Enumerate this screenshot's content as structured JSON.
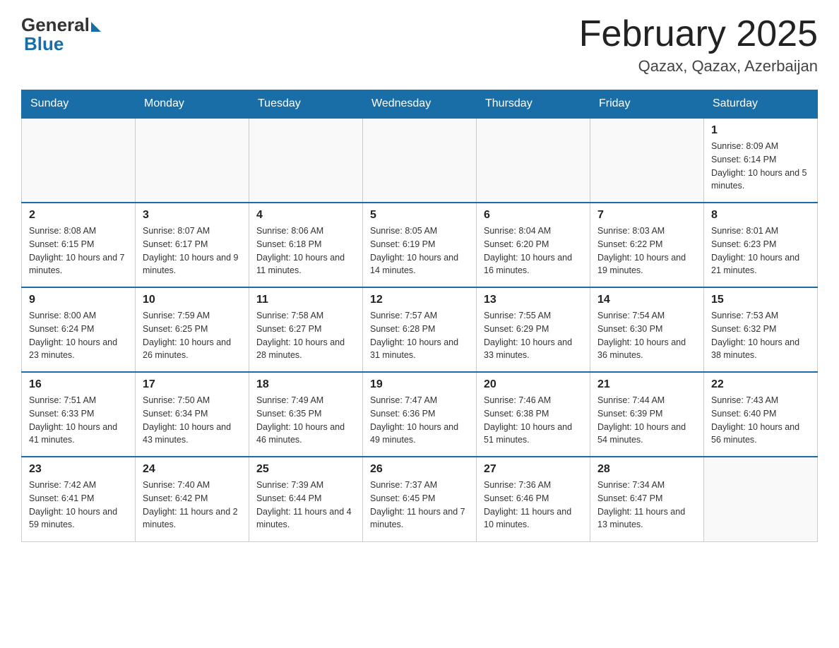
{
  "header": {
    "logo_general": "General",
    "logo_blue": "Blue",
    "main_title": "February 2025",
    "subtitle": "Qazax, Qazax, Azerbaijan"
  },
  "weekdays": [
    "Sunday",
    "Monday",
    "Tuesday",
    "Wednesday",
    "Thursday",
    "Friday",
    "Saturday"
  ],
  "weeks": [
    [
      {
        "day": "",
        "info": ""
      },
      {
        "day": "",
        "info": ""
      },
      {
        "day": "",
        "info": ""
      },
      {
        "day": "",
        "info": ""
      },
      {
        "day": "",
        "info": ""
      },
      {
        "day": "",
        "info": ""
      },
      {
        "day": "1",
        "info": "Sunrise: 8:09 AM\nSunset: 6:14 PM\nDaylight: 10 hours and 5 minutes."
      }
    ],
    [
      {
        "day": "2",
        "info": "Sunrise: 8:08 AM\nSunset: 6:15 PM\nDaylight: 10 hours and 7 minutes."
      },
      {
        "day": "3",
        "info": "Sunrise: 8:07 AM\nSunset: 6:17 PM\nDaylight: 10 hours and 9 minutes."
      },
      {
        "day": "4",
        "info": "Sunrise: 8:06 AM\nSunset: 6:18 PM\nDaylight: 10 hours and 11 minutes."
      },
      {
        "day": "5",
        "info": "Sunrise: 8:05 AM\nSunset: 6:19 PM\nDaylight: 10 hours and 14 minutes."
      },
      {
        "day": "6",
        "info": "Sunrise: 8:04 AM\nSunset: 6:20 PM\nDaylight: 10 hours and 16 minutes."
      },
      {
        "day": "7",
        "info": "Sunrise: 8:03 AM\nSunset: 6:22 PM\nDaylight: 10 hours and 19 minutes."
      },
      {
        "day": "8",
        "info": "Sunrise: 8:01 AM\nSunset: 6:23 PM\nDaylight: 10 hours and 21 minutes."
      }
    ],
    [
      {
        "day": "9",
        "info": "Sunrise: 8:00 AM\nSunset: 6:24 PM\nDaylight: 10 hours and 23 minutes."
      },
      {
        "day": "10",
        "info": "Sunrise: 7:59 AM\nSunset: 6:25 PM\nDaylight: 10 hours and 26 minutes."
      },
      {
        "day": "11",
        "info": "Sunrise: 7:58 AM\nSunset: 6:27 PM\nDaylight: 10 hours and 28 minutes."
      },
      {
        "day": "12",
        "info": "Sunrise: 7:57 AM\nSunset: 6:28 PM\nDaylight: 10 hours and 31 minutes."
      },
      {
        "day": "13",
        "info": "Sunrise: 7:55 AM\nSunset: 6:29 PM\nDaylight: 10 hours and 33 minutes."
      },
      {
        "day": "14",
        "info": "Sunrise: 7:54 AM\nSunset: 6:30 PM\nDaylight: 10 hours and 36 minutes."
      },
      {
        "day": "15",
        "info": "Sunrise: 7:53 AM\nSunset: 6:32 PM\nDaylight: 10 hours and 38 minutes."
      }
    ],
    [
      {
        "day": "16",
        "info": "Sunrise: 7:51 AM\nSunset: 6:33 PM\nDaylight: 10 hours and 41 minutes."
      },
      {
        "day": "17",
        "info": "Sunrise: 7:50 AM\nSunset: 6:34 PM\nDaylight: 10 hours and 43 minutes."
      },
      {
        "day": "18",
        "info": "Sunrise: 7:49 AM\nSunset: 6:35 PM\nDaylight: 10 hours and 46 minutes."
      },
      {
        "day": "19",
        "info": "Sunrise: 7:47 AM\nSunset: 6:36 PM\nDaylight: 10 hours and 49 minutes."
      },
      {
        "day": "20",
        "info": "Sunrise: 7:46 AM\nSunset: 6:38 PM\nDaylight: 10 hours and 51 minutes."
      },
      {
        "day": "21",
        "info": "Sunrise: 7:44 AM\nSunset: 6:39 PM\nDaylight: 10 hours and 54 minutes."
      },
      {
        "day": "22",
        "info": "Sunrise: 7:43 AM\nSunset: 6:40 PM\nDaylight: 10 hours and 56 minutes."
      }
    ],
    [
      {
        "day": "23",
        "info": "Sunrise: 7:42 AM\nSunset: 6:41 PM\nDaylight: 10 hours and 59 minutes."
      },
      {
        "day": "24",
        "info": "Sunrise: 7:40 AM\nSunset: 6:42 PM\nDaylight: 11 hours and 2 minutes."
      },
      {
        "day": "25",
        "info": "Sunrise: 7:39 AM\nSunset: 6:44 PM\nDaylight: 11 hours and 4 minutes."
      },
      {
        "day": "26",
        "info": "Sunrise: 7:37 AM\nSunset: 6:45 PM\nDaylight: 11 hours and 7 minutes."
      },
      {
        "day": "27",
        "info": "Sunrise: 7:36 AM\nSunset: 6:46 PM\nDaylight: 11 hours and 10 minutes."
      },
      {
        "day": "28",
        "info": "Sunrise: 7:34 AM\nSunset: 6:47 PM\nDaylight: 11 hours and 13 minutes."
      },
      {
        "day": "",
        "info": ""
      }
    ]
  ]
}
